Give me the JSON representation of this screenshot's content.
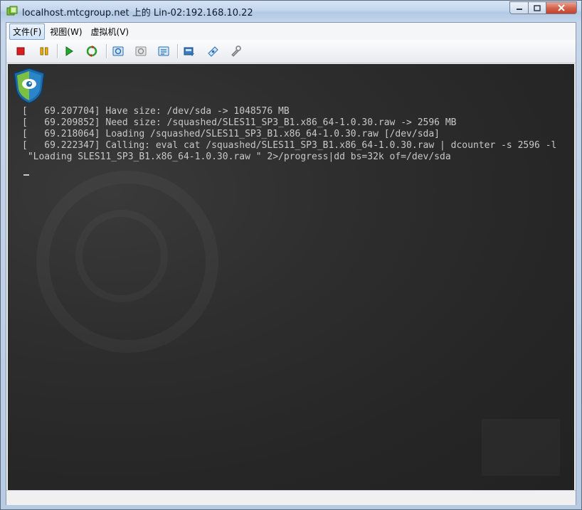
{
  "window": {
    "title": "localhost.mtcgroup.net 上的 Lin-02:192.168.10.22"
  },
  "menu": {
    "items": [
      "文件(F)",
      "视图(W)",
      "虚拟机(V)"
    ]
  },
  "toolbar": {
    "buttons": [
      {
        "icon": "stop-icon",
        "color": "#d81e1e"
      },
      {
        "icon": "pause-icon",
        "color": "#e8a200"
      },
      {
        "icon": "play-icon",
        "color": "#1e9a2a"
      },
      {
        "icon": "reset-icon",
        "color": "#2f9a2f"
      },
      {
        "icon": "snapshot-icon"
      },
      {
        "icon": "revert-snapshot-icon"
      },
      {
        "icon": "manage-snapshots-icon"
      },
      {
        "icon": "cd-drive-icon"
      },
      {
        "icon": "floppy-drive-icon"
      },
      {
        "icon": "settings-icon"
      }
    ]
  },
  "console": {
    "lines": [
      "[   69.207704] Have size: /dev/sda -> 1048576 MB",
      "[   69.209852] Need size: /squashed/SLES11_SP3_B1.x86_64-1.0.30.raw -> 2596 MB",
      "[   69.218064] Loading /squashed/SLES11_SP3_B1.x86_64-1.0.30.raw [/dev/sda]",
      "[   69.222347] Calling: eval cat /squashed/SLES11_SP3_B1.x86_64-1.0.30.raw | dcounter -s 2596 -l",
      " \"Loading SLES11_SP3_B1.x86_64-1.0.30.raw \" 2>/progress|dd bs=32k of=/dev/sda"
    ]
  }
}
